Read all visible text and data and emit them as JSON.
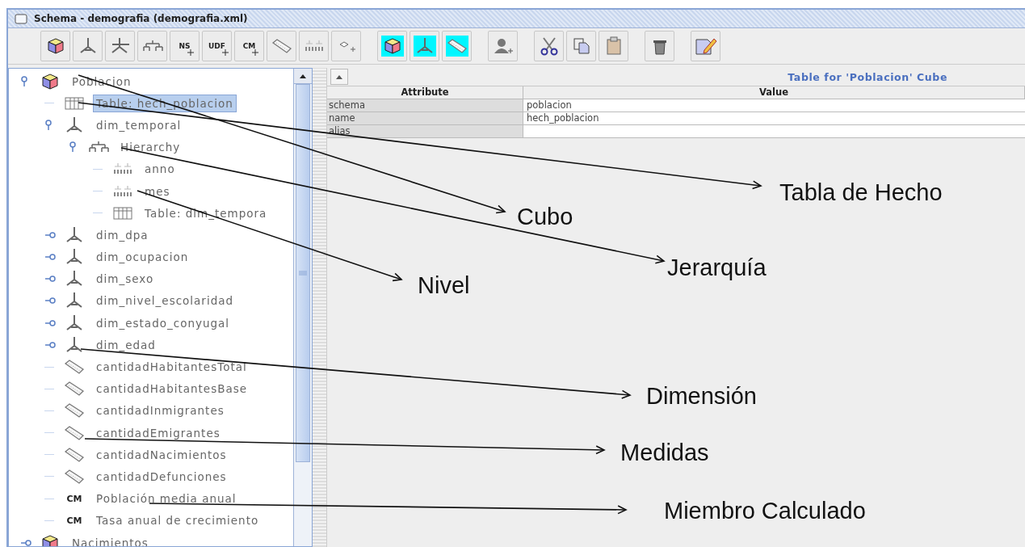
{
  "window": {
    "title": "Schema - demografia (demografia.xml)"
  },
  "toolbar": {
    "groups": [
      {
        "buttons": [
          {
            "kind": "cube",
            "active": false
          },
          {
            "kind": "dimension",
            "active": false
          },
          {
            "kind": "dimension-usage",
            "active": false
          },
          {
            "kind": "hierarchy",
            "active": false
          },
          {
            "kind": "text",
            "label": "NS",
            "active": false
          },
          {
            "kind": "text",
            "label": "UDF",
            "active": false
          },
          {
            "kind": "text",
            "label": "CM",
            "active": false
          },
          {
            "kind": "measure",
            "active": false
          },
          {
            "kind": "level",
            "active": false
          },
          {
            "kind": "property",
            "active": false
          }
        ]
      },
      {
        "buttons": [
          {
            "kind": "cube",
            "active": true
          },
          {
            "kind": "dimension",
            "active": true
          },
          {
            "kind": "measure",
            "active": true
          }
        ]
      },
      {
        "buttons": [
          {
            "kind": "role",
            "active": false
          }
        ]
      },
      {
        "buttons": [
          {
            "kind": "cut",
            "active": false
          },
          {
            "kind": "copy",
            "active": false
          },
          {
            "kind": "paste",
            "active": false
          }
        ]
      },
      {
        "buttons": [
          {
            "kind": "delete",
            "active": false
          }
        ]
      },
      {
        "buttons": [
          {
            "kind": "edit",
            "active": false
          }
        ]
      }
    ]
  },
  "tree": {
    "items": [
      {
        "kind": "cube",
        "label": "Poblacion",
        "expanded": true,
        "selected": false,
        "children": [
          {
            "kind": "table",
            "label": "Table: hech_poblacion",
            "selected": true
          },
          {
            "kind": "dimension",
            "label": "dim_temporal",
            "expanded": true,
            "selected": false,
            "children": [
              {
                "kind": "hierarchy",
                "label": "Hierarchy",
                "expanded": true,
                "selected": false,
                "children": [
                  {
                    "kind": "level",
                    "label": "anno",
                    "selected": false
                  },
                  {
                    "kind": "level",
                    "label": "mes",
                    "selected": false
                  },
                  {
                    "kind": "table",
                    "label": "Table: dim_tempora",
                    "selected": false
                  }
                ]
              }
            ]
          },
          {
            "kind": "dimension",
            "label": "dim_dpa",
            "expanded": false,
            "selected": false
          },
          {
            "kind": "dimension",
            "label": "dim_ocupacion",
            "expanded": false,
            "selected": false
          },
          {
            "kind": "dimension",
            "label": "dim_sexo",
            "expanded": false,
            "selected": false
          },
          {
            "kind": "dimension",
            "label": "dim_nivel_escolaridad",
            "expanded": false,
            "selected": false
          },
          {
            "kind": "dimension",
            "label": "dim_estado_conyugal",
            "expanded": false,
            "selected": false
          },
          {
            "kind": "dimension",
            "label": "dim_edad",
            "expanded": false,
            "selected": false
          },
          {
            "kind": "measure",
            "label": "cantidadHabitantesTotal",
            "selected": false
          },
          {
            "kind": "measure",
            "label": "cantidadHabitantesBase",
            "selected": false
          },
          {
            "kind": "measure",
            "label": "cantidadInmigrantes",
            "selected": false
          },
          {
            "kind": "measure",
            "label": "cantidadEmigrantes",
            "selected": false
          },
          {
            "kind": "measure",
            "label": "cantidadNacimientos",
            "selected": false
          },
          {
            "kind": "measure",
            "label": "cantidadDefunciones",
            "selected": false
          },
          {
            "kind": "calculated",
            "icon_text": "CM",
            "label": "Población media anual",
            "selected": false
          },
          {
            "kind": "calculated",
            "icon_text": "CM",
            "label": "Tasa anual de crecimiento",
            "selected": false
          }
        ]
      },
      {
        "kind": "cube",
        "label": "Nacimientos",
        "expanded": false,
        "selected": false
      }
    ]
  },
  "details": {
    "title": "Table for 'Poblacion' Cube",
    "columns": [
      "Attribute",
      "Value"
    ],
    "rows": [
      {
        "attribute": "schema",
        "value": "poblacion"
      },
      {
        "attribute": "name",
        "value": "hech_poblacion"
      },
      {
        "attribute": "alias"
      }
    ]
  },
  "annotations": [
    {
      "label": "Tabla de Hecho"
    },
    {
      "label": "Cubo"
    },
    {
      "label": "Jerarquía"
    },
    {
      "label": "Nivel"
    },
    {
      "label": "Dimensión"
    },
    {
      "label": "Medidas"
    },
    {
      "label": "Miembro Calculado"
    }
  ]
}
